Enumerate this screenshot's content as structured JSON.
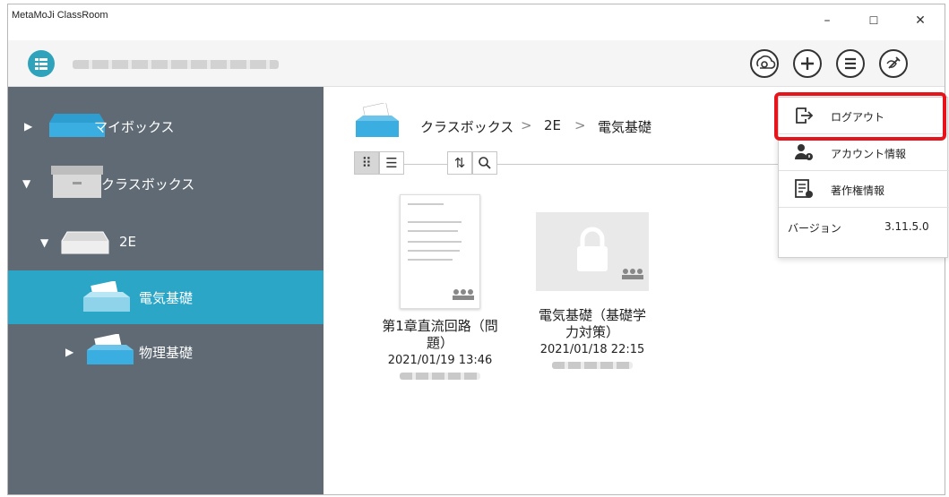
{
  "window": {
    "title": "MetaMoJi ClassRoom",
    "minimize": "–",
    "maximize": "☐",
    "close": "✕"
  },
  "toolbar": {
    "icons": [
      "camera-icon",
      "plus-icon",
      "list-icon",
      "pen-icon"
    ]
  },
  "sidebar": {
    "items": [
      {
        "label": "マイボックス"
      },
      {
        "label": "クラスボックス"
      },
      {
        "label": "2E"
      },
      {
        "label": "電気基礎"
      },
      {
        "label": "物理基礎"
      }
    ]
  },
  "breadcrumb": {
    "root": "クラスボックス",
    "sep1": ">",
    "class": "2E",
    "sep2": ">",
    "current": "電気基礎"
  },
  "files": [
    {
      "name_line1": "第1章直流回路（問",
      "name_line2": "題）",
      "date": "2021/01/19 13:46"
    },
    {
      "name_line1": "電気基礎（基礎学",
      "name_line2": "力対策）",
      "date": "2021/01/18 22:15"
    }
  ],
  "popup": {
    "logout": "ログアウト",
    "account": "アカウント情報",
    "copyright": "著作権情報",
    "version_label": "バージョン",
    "version_value": "3.11.5.0"
  },
  "colors": {
    "accent": "#2ba6c7",
    "sidebar": "#5f6a75",
    "highlight": "#e8141c"
  }
}
